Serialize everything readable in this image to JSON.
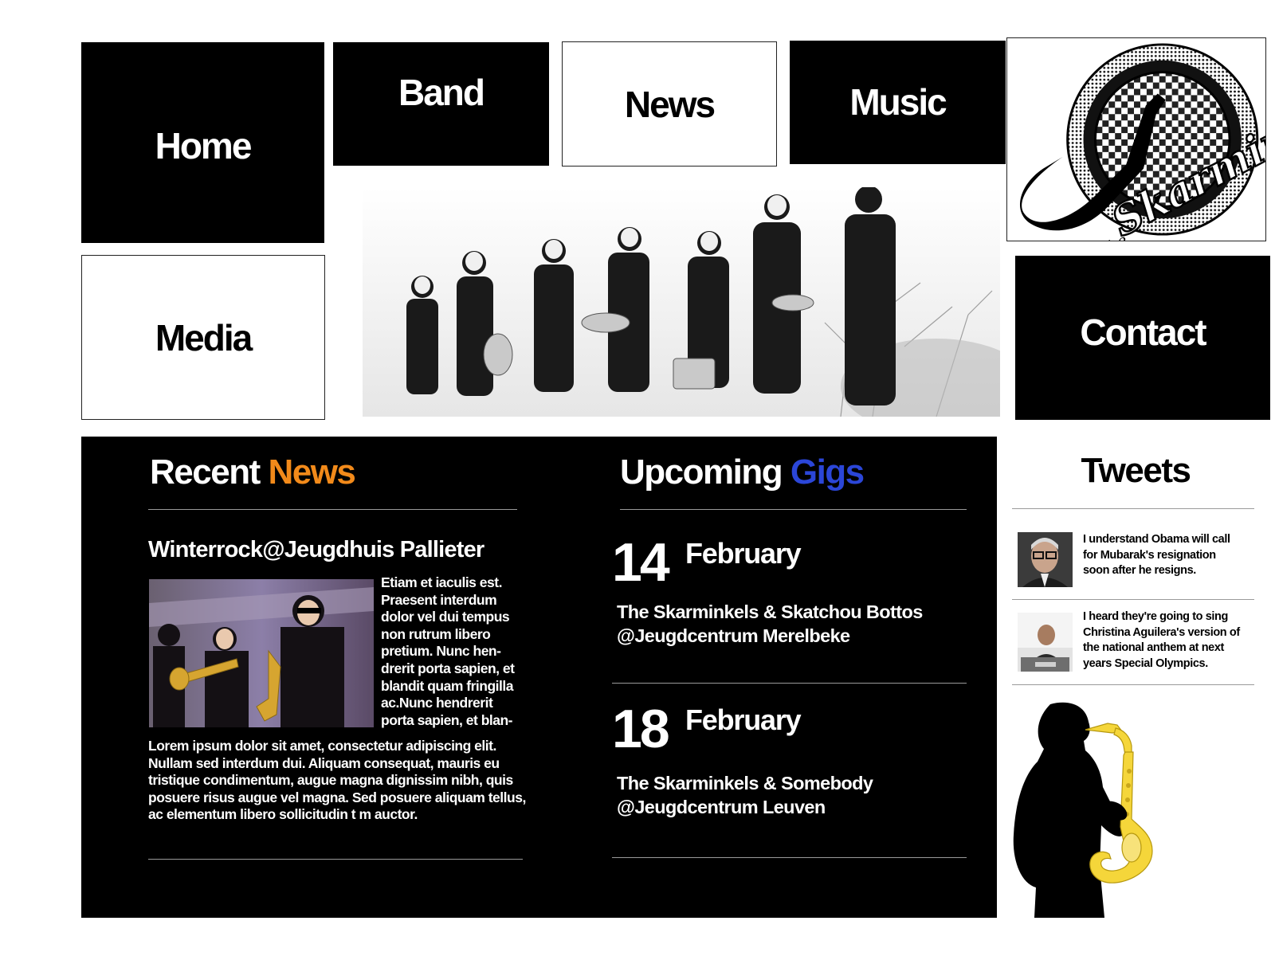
{
  "nav": {
    "home": "Home",
    "band": "Band",
    "news": "News",
    "music": "Music",
    "media": "Media",
    "contact": "Contact"
  },
  "logo": {
    "icon": "skarminkels-saxophone-logo"
  },
  "hero": {
    "icon": "band-group-photo"
  },
  "recent_news": {
    "title_part1": "Recent",
    "title_part2": "News",
    "accent_color": "#F28A1A",
    "headline": "Winterrock@Jeugdhuis Pallieter",
    "side_lines": [
      "Etiam et iaculis est.",
      "Praesent interdum",
      "dolor vel dui tempus",
      "non rutrum libero",
      "pretium. Nunc hen-",
      "drerit porta sapien, et",
      "blandit quam fringilla",
      "ac.Nunc hendrerit",
      "porta sapien, et blan-"
    ],
    "body_lines": [
      "Lorem ipsum dolor sit amet, consectetur adipiscing elit.",
      "Nullam sed interdum dui. Aliquam consequat, mauris eu",
      "tristique condimentum, augue magna dignissim nibh, quis",
      "posuere risus augue vel magna. Sed posuere aliquam tellus,",
      "ac elementum libero sollicitudin t m auctor."
    ]
  },
  "upcoming_gigs": {
    "title_part1": "Upcoming",
    "title_part2": "Gigs",
    "accent_color": "#2B46D8",
    "items": [
      {
        "day": "14",
        "month": "February",
        "line1": "The Skarminkels & Skatchou Bottos",
        "line2": "@Jeugdcentrum Merelbeke"
      },
      {
        "day": "18",
        "month": "February",
        "line1": "The Skarminkels & Somebody",
        "line2": "@Jeugdcentrum Leuven"
      }
    ]
  },
  "tweets": {
    "title": "Tweets",
    "items": [
      {
        "lines": [
          "I understand Obama will call",
          "for Mubarak's resignation",
          "soon after he resigns."
        ]
      },
      {
        "lines": [
          "I heard they're going to sing",
          "Christina Aguilera's version of",
          "the national anthem at next",
          "years Special Olympics."
        ]
      }
    ]
  },
  "colors": {
    "panel_bg": "#000000",
    "sax_yellow": "#F5D63A"
  }
}
